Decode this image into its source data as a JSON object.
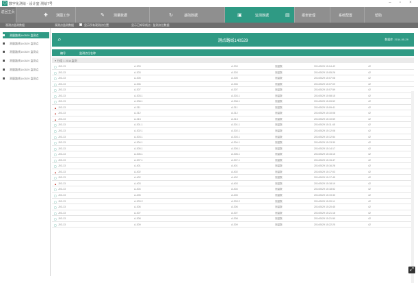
{
  "window": {
    "title": "数字化测绘 - 设计室·测绘7号",
    "controls": {
      "minimize": "–",
      "maximize": "▫",
      "close": "×"
    }
  },
  "nav": {
    "home_label": "返回主页",
    "items": [
      {
        "label": "测图工作",
        "icon": "survey-icon"
      },
      {
        "label": "测量数据",
        "icon": "pencil-icon"
      },
      {
        "label": "基础数据",
        "icon": "refresh-icon"
      },
      {
        "label": "监测数据",
        "icon": "monitor-icon",
        "active": true
      },
      {
        "label": "报表管理",
        "icon": "table-icon"
      },
      {
        "label": "系统配置",
        "icon": ""
      },
      {
        "label": "帮助",
        "icon": ""
      }
    ]
  },
  "subbar": {
    "items": [
      "观测点监测数据",
      "观测点监测数据",
      "显示所有观测点位置",
      "显示已知导线点 · 监测点位数据"
    ]
  },
  "sidebar": {
    "items": [
      {
        "label": "测量路线140529 监测点",
        "active": true
      },
      {
        "label": "测量路线140529 监测点"
      },
      {
        "label": "测量路线140529 监测点"
      },
      {
        "label": "测量路线140529 监测点"
      },
      {
        "label": "测量路线140529 监测点"
      },
      {
        "label": "测量路线140529 监测点"
      }
    ]
  },
  "main": {
    "title": "测点路线140529",
    "right_info": "数据库: 2014-05-29",
    "columns": [
      "编号",
      "监测点位名称",
      "观测值",
      "平差值",
      "状态",
      "观测时间",
      "期数"
    ],
    "group_label": "▾ 分组 1    2014监测",
    "rows": [
      {
        "flag": "ok",
        "id": "J03-13",
        "a": "A-303",
        "b": "A-303",
        "s": "测量数",
        "t": "2014/5/29 15:04:42",
        "n": "42"
      },
      {
        "flag": "ok",
        "id": "J03-13",
        "a": "A-303",
        "b": "A-303",
        "s": "测量数",
        "t": "2014/5/29 15:05:26",
        "n": "42"
      },
      {
        "flag": "ok",
        "id": "J03-13",
        "a": "A-305",
        "b": "A-305",
        "s": "测量数",
        "t": "2014/5/29 15:07:08",
        "n": "42"
      },
      {
        "flag": "ok",
        "id": "J03-13",
        "a": "A-306",
        "b": "A-306",
        "s": "测量数",
        "t": "2014/5/29 15:07:09",
        "n": "42"
      },
      {
        "flag": "ok",
        "id": "J03-13",
        "a": "A-307",
        "b": "A-307",
        "s": "测量数",
        "t": "2014/5/29 15:07:59",
        "n": "42"
      },
      {
        "flag": "ok",
        "id": "J03-13",
        "a": "A-303.1",
        "b": "A-303.1",
        "s": "测量数",
        "t": "2014/5/29 15:08:15",
        "n": "42"
      },
      {
        "flag": "ok",
        "id": "J03-13",
        "a": "A-308.1",
        "b": "A-308.1",
        "s": "测量数",
        "t": "2014/5/29 15:09:52",
        "n": "42"
      },
      {
        "flag": "warn",
        "id": "J03-13",
        "a": "A-311",
        "b": "A-311",
        "s": "测量数",
        "t": "2014/5/29 15:09:41",
        "n": "42"
      },
      {
        "flag": "warn",
        "id": "J03-13",
        "a": "A-312",
        "b": "A-312",
        "s": "测量数",
        "t": "2014/5/29 15:10:08",
        "n": "42"
      },
      {
        "flag": "warn",
        "id": "J03-13",
        "a": "A-313",
        "b": "A-313",
        "s": "测量数",
        "t": "2014/5/29 15:10:59",
        "n": "42"
      },
      {
        "flag": "ok",
        "id": "J03-13",
        "a": "A-301.1",
        "b": "A-301.1",
        "s": "测量数",
        "t": "2014/5/29 15:11:45",
        "n": "42"
      },
      {
        "flag": "ok",
        "id": "J03-13",
        "a": "A-302.1",
        "b": "A-302.1",
        "s": "测量数",
        "t": "2014/5/29 15:12:08",
        "n": "42"
      },
      {
        "flag": "ok",
        "id": "J03-13",
        "a": "A-303.1",
        "b": "A-303.1",
        "s": "测量数",
        "t": "2014/5/29 15:12:54",
        "n": "42"
      },
      {
        "flag": "ok",
        "id": "J03-13",
        "a": "A-304.1",
        "b": "A-304.1",
        "s": "测量数",
        "t": "2014/5/29 15:13:30",
        "n": "42"
      },
      {
        "flag": "ok",
        "id": "J03-13",
        "a": "A-305.1",
        "b": "A-305.1",
        "s": "测量数",
        "t": "2014/5/29 15:14:17",
        "n": "42"
      },
      {
        "flag": "ok",
        "id": "J03-13",
        "a": "A-306.1",
        "b": "A-306.1",
        "s": "测量数",
        "t": "2014/5/29 15:15:15",
        "n": "42"
      },
      {
        "flag": "ok",
        "id": "J03-13",
        "a": "A-307.1",
        "b": "A-307.1",
        "s": "测量数",
        "t": "2014/5/29 15:15:47",
        "n": "42"
      },
      {
        "flag": "ok",
        "id": "J03-13",
        "a": "A-401",
        "b": "A-401",
        "s": "测量数",
        "t": "2014/5/29 15:16:28",
        "n": "42"
      },
      {
        "flag": "warn",
        "id": "J03-13",
        "a": "A-402",
        "b": "A-402",
        "s": "测量数",
        "t": "2014/5/29 15:17:03",
        "n": "42"
      },
      {
        "flag": "ok",
        "id": "J03-13",
        "a": "A-402",
        "b": "A-402",
        "s": "测量数",
        "t": "2014/5/29 15:17:45",
        "n": "42"
      },
      {
        "flag": "warn",
        "id": "J03-13",
        "a": "A-403",
        "b": "A-403",
        "s": "测量数",
        "t": "2014/5/29 15:18:19",
        "n": "42"
      },
      {
        "flag": "ok",
        "id": "J03-13",
        "a": "A-404",
        "b": "A-404",
        "s": "测量数",
        "t": "2014/5/29 15:18:52",
        "n": "42"
      },
      {
        "flag": "ok",
        "id": "J03-13",
        "a": "A-405",
        "b": "A-405",
        "s": "测量数",
        "t": "2014/5/29 15:19:30",
        "n": "42"
      },
      {
        "flag": "ok",
        "id": "J03-13",
        "a": "A-303.2",
        "b": "A-303.2",
        "s": "测量数",
        "t": "2014/5/29 15:20:11",
        "n": "42"
      },
      {
        "flag": "ok",
        "id": "J03-13",
        "a": "A-306",
        "b": "A-306",
        "s": "测量数",
        "t": "2014/5/29 15:20:45",
        "n": "42"
      },
      {
        "flag": "ok",
        "id": "J03-13",
        "a": "A-307",
        "b": "A-307",
        "s": "测量数",
        "t": "2014/5/29 15:21:18",
        "n": "42"
      },
      {
        "flag": "ok",
        "id": "J03-13",
        "a": "A-308",
        "b": "A-308",
        "s": "测量数",
        "t": "2014/5/29 15:21:50",
        "n": "42"
      },
      {
        "flag": "ok",
        "id": "J03-13",
        "a": "A-309",
        "b": "A-309",
        "s": "测量数",
        "t": "2014/5/29 15:22:25",
        "n": "42"
      }
    ]
  },
  "colors": {
    "accent": "#2f9a84",
    "nav": "#8f8f8f",
    "warn": "#c0392b"
  }
}
